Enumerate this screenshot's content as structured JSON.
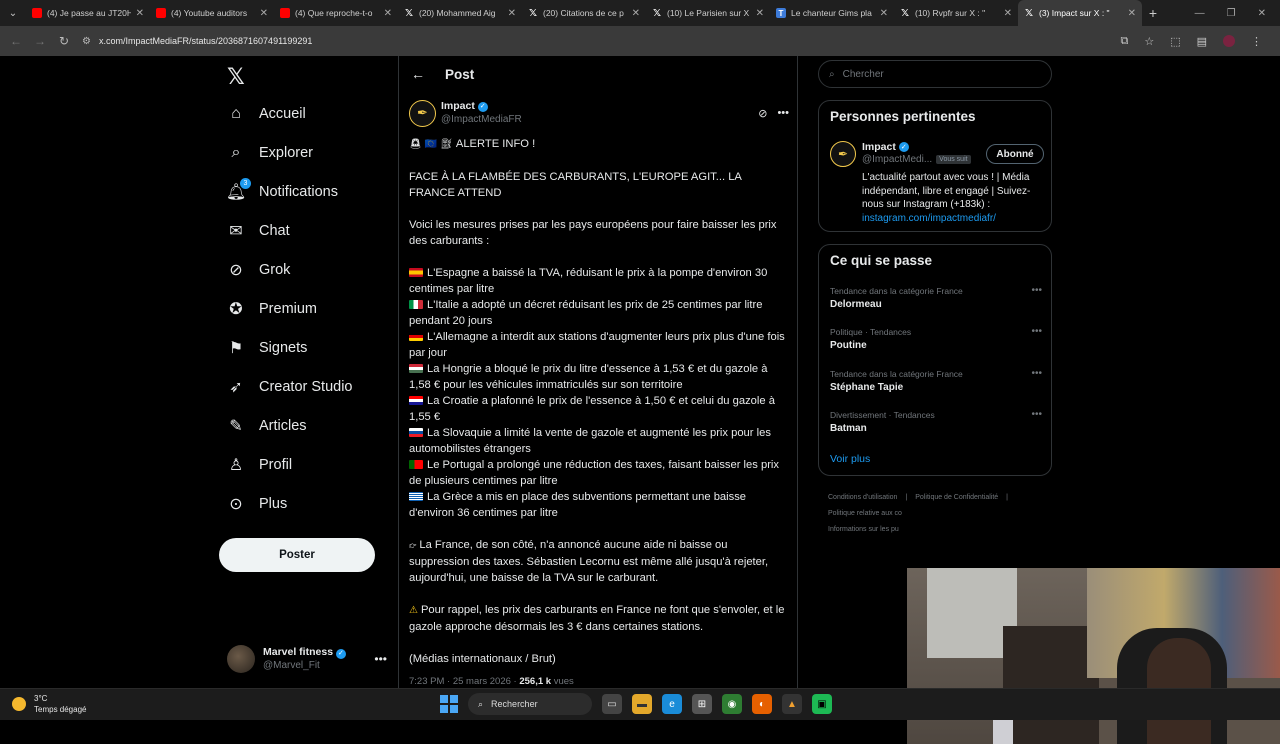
{
  "browser": {
    "tabs": [
      {
        "title": "(4) Je passe au JT20H",
        "fav": "yt"
      },
      {
        "title": "(4) Youtube auditors",
        "fav": "yt"
      },
      {
        "title": "(4) Que reproche-t-o",
        "fav": "yt"
      },
      {
        "title": "(20) Mohammed Aig",
        "fav": "x"
      },
      {
        "title": "(20) Citations de ce p",
        "fav": "x"
      },
      {
        "title": "(10) Le Parisien sur X",
        "fav": "x"
      },
      {
        "title": "Le chanteur Gims pla",
        "fav": "w"
      },
      {
        "title": "(10) Rvpfr sur X : \"",
        "fav": "x"
      },
      {
        "title": "(3) Impact sur X : \"",
        "fav": "x",
        "active": true
      }
    ],
    "url": "x.com/ImpactMediaFR/status/2036871607491199291"
  },
  "nav": {
    "items": [
      {
        "label": "Accueil",
        "icon": "home-icon"
      },
      {
        "label": "Explorer",
        "icon": "search-icon"
      },
      {
        "label": "Notifications",
        "icon": "bell-icon",
        "badge": "3"
      },
      {
        "label": "Chat",
        "icon": "mail-icon"
      },
      {
        "label": "Grok",
        "icon": "grok-icon"
      },
      {
        "label": "Premium",
        "icon": "premium-icon"
      },
      {
        "label": "Signets",
        "icon": "bookmark-icon"
      },
      {
        "label": "Creator Studio",
        "icon": "rocket-icon"
      },
      {
        "label": "Articles",
        "icon": "article-icon"
      },
      {
        "label": "Profil",
        "icon": "person-icon"
      },
      {
        "label": "Plus",
        "icon": "more-icon"
      }
    ],
    "post_button": "Poster",
    "account": {
      "display_name": "Marvel fitness",
      "handle": "@Marvel_Fit"
    }
  },
  "post": {
    "header": "Post",
    "author": {
      "name": "Impact",
      "handle": "@ImpactMediaFR"
    },
    "lines": {
      "alert": "ALERTE INFO !",
      "headline": "FACE À LA FLAMBÉE DES CARBURANTS, L'EUROPE AGIT... LA FRANCE ATTEND",
      "intro": "Voici les mesures prises par les pays européens pour faire baisser les prix des carburants :",
      "es": "L'Espagne a baissé la TVA, réduisant le prix à la pompe d'environ 30 centimes par litre",
      "it": "L'Italie a adopté un décret réduisant les prix de 25 centimes par litre pendant 20 jours",
      "de": "L'Allemagne a interdit aux stations d'augmenter leurs prix plus d'une fois par jour",
      "hu": "La Hongrie a bloqué le prix du litre d'essence à 1,53 € et du gazole à 1,58 € pour les véhicules immatriculés sur son territoire",
      "hr": "La Croatie a plafonné le prix de l'essence à 1,50 € et celui du gazole à 1,55 €",
      "sk": "La Slovaquie a limité la vente de gazole et augmenté les prix pour les automobilistes étrangers",
      "pt": "Le Portugal a prolongé une réduction des taxes, faisant baisser les prix de plusieurs centimes par litre",
      "gr": "La Grèce a mis en place des subventions permettant une baisse d'environ 36 centimes par litre",
      "france": "La France, de son côté, n'a annoncé aucune aide ni baisse ou suppression des taxes. Sébastien Lecornu est même allé jusqu'à rejeter, aujourd'hui, une baisse de la TVA sur le carburant.",
      "reminder": "Pour rappel, les prix des carburants en France ne font que s'envoler, et le gazole approche désormais les 3 € dans certaines stations.",
      "source": "(Médias internationaux / Brut)"
    },
    "meta": {
      "time": "7:23 PM · 25 mars 2026 ·",
      "views": "256,1 k",
      "views_label": "vues"
    }
  },
  "sidebar": {
    "search_placeholder": "Chercher",
    "relevant": {
      "title": "Personnes pertinentes",
      "name": "Impact",
      "handle": "@ImpactMedi...",
      "follows_you": "Vous suit",
      "follow_btn": "Abonné",
      "bio": "L'actualité partout avec vous ! | Média indépendant, libre et engagé | Suivez-nous sur Instagram (+183k) :",
      "bio_link": "instagram.com/impactmediafr/"
    },
    "trends": {
      "title": "Ce qui se passe",
      "items": [
        {
          "category": "Tendance dans la catégorie France",
          "name": "Delormeau"
        },
        {
          "category": "Politique · Tendances",
          "name": "Poutine"
        },
        {
          "category": "Tendance dans la catégorie France",
          "name": "Stéphane Tapie"
        },
        {
          "category": "Divertissement · Tendances",
          "name": "Batman"
        }
      ],
      "more": "Voir plus"
    },
    "footer": [
      "Conditions d'utilisation",
      "Politique de Confidentialité",
      "Politique relative aux co",
      "Informations sur les pu"
    ]
  },
  "taskbar": {
    "temp": "3°C",
    "weather": "Temps dégagé",
    "search": "Rechercher"
  }
}
